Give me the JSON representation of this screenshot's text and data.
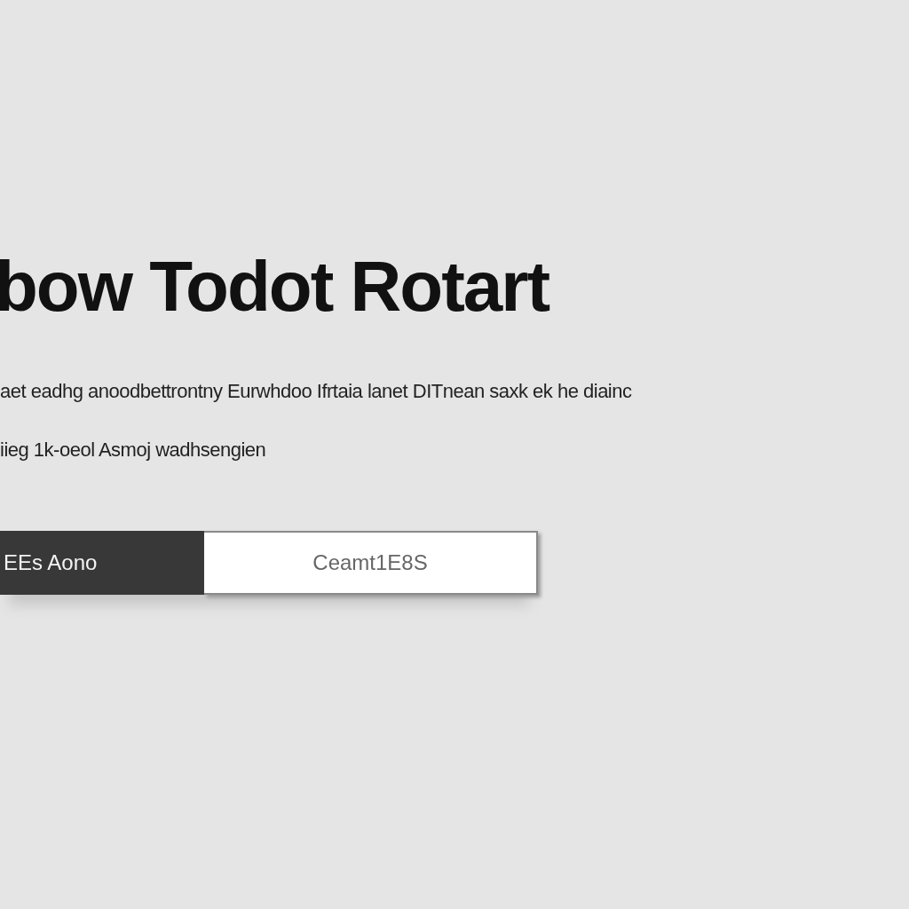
{
  "heading": "bow Todot Rotart",
  "paragraph_lines": [
    "aet eadhg anoodbettrontny Eurwhdoo Ifrtaia lanet DITnean saxk ek he diainc",
    "iieg 1k-oeol Asmoj wadhsengien"
  ],
  "buttons": [
    {
      "label": "EEs Aono",
      "kind": "primary"
    },
    {
      "label": "Ceamt1E8S",
      "kind": "secondary"
    }
  ]
}
